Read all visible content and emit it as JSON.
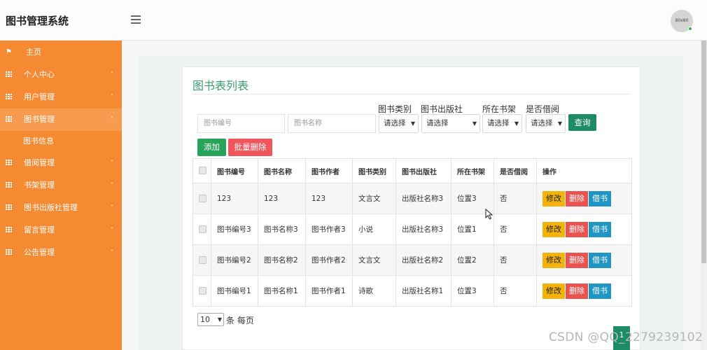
{
  "app": {
    "title": "图书管理系统",
    "avatar_text": "80x80"
  },
  "sidebar": {
    "items": [
      {
        "label": "主页",
        "icon": "flag-icon",
        "has_caret": false
      },
      {
        "label": "个人中心",
        "icon": "grid-icon",
        "has_caret": true
      },
      {
        "label": "用户管理",
        "icon": "grid-icon",
        "has_caret": true
      },
      {
        "label": "图书管理",
        "icon": "grid-icon",
        "has_caret": true,
        "expanded": true
      },
      {
        "label": "图书信息",
        "sub": true
      },
      {
        "label": "借阅管理",
        "icon": "grid-icon",
        "has_caret": true
      },
      {
        "label": "书架管理",
        "icon": "grid-icon",
        "has_caret": true
      },
      {
        "label": "图书出版社管理",
        "icon": "grid-icon",
        "has_caret": true
      },
      {
        "label": "留言管理",
        "icon": "grid-icon",
        "has_caret": true
      },
      {
        "label": "公告管理",
        "icon": "grid-icon",
        "has_caret": true
      }
    ],
    "caret_down": "˅",
    "caret_up": "˄"
  },
  "main": {
    "title": "图书表列表",
    "search": {
      "book_no_placeholder": "图书编号",
      "book_name_placeholder": "图书名称",
      "category_label": "图书类别",
      "publisher_label": "图书出版社",
      "shelf_label": "所在书架",
      "borrowed_label": "是否借阅",
      "select_placeholder": "请选择",
      "query_label": "查询"
    },
    "actions": {
      "add_label": "添加",
      "batch_delete_label": "批量删除"
    },
    "table": {
      "headers": [
        "图书编号",
        "图书名称",
        "图书作者",
        "图书类别",
        "图书出版社",
        "所在书架",
        "是否借阅",
        "操作"
      ],
      "rows": [
        [
          "123",
          "123",
          "123",
          "文言文",
          "出版社名称3",
          "位置3",
          "否"
        ],
        [
          "图书编号3",
          "图书名称3",
          "图书作者3",
          "小说",
          "出版社名称3",
          "位置1",
          "否"
        ],
        [
          "图书编号2",
          "图书名称2",
          "图书作者2",
          "文言文",
          "出版社名称2",
          "位置2",
          "否"
        ],
        [
          "图书编号1",
          "图书名称1",
          "图书作者1",
          "诗歌",
          "出版社名称1",
          "位置3",
          "否"
        ]
      ],
      "row_actions": {
        "edit": "修改",
        "delete": "删除",
        "borrow": "借书"
      }
    },
    "pagination": {
      "page_size": "10",
      "per_page_label": "条 每页",
      "current_page": "1"
    }
  },
  "watermark": "CSDN @QQ_2279239102",
  "colors": {
    "sidebar": "#f58a32",
    "accent": "#1d8b63",
    "title": "#3a9b6e"
  }
}
